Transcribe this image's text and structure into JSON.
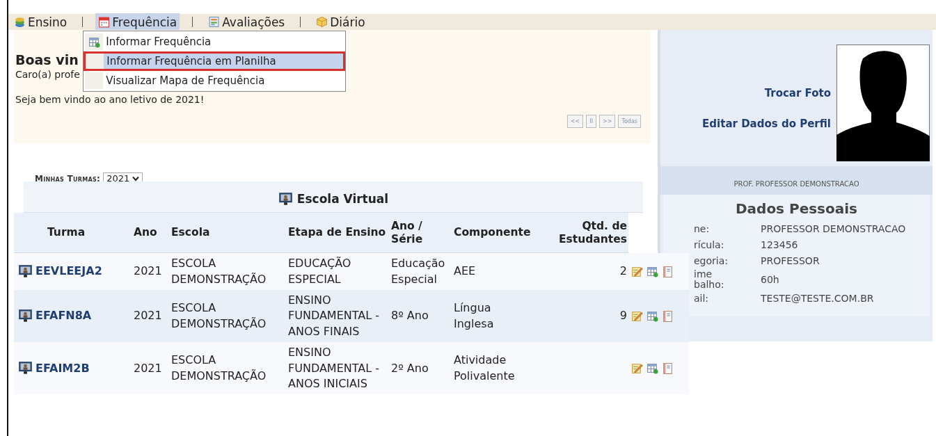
{
  "menu": [
    {
      "label": "Ensino",
      "kind": "books",
      "selected": false
    },
    {
      "label": "Frequência",
      "kind": "calendar",
      "selected": true
    },
    {
      "label": "Avaliações",
      "kind": "form",
      "selected": false
    },
    {
      "label": "Diário",
      "kind": "box",
      "selected": false
    }
  ],
  "dropdown": [
    {
      "label": "Informar Frequência",
      "kind": "sheet",
      "selected": false
    },
    {
      "label": "Informar Frequência em Planilha",
      "kind": "none",
      "selected": true
    },
    {
      "label": "Visualizar Mapa de Frequência",
      "kind": "none",
      "selected": false
    }
  ],
  "welcome": {
    "title": "Boas vin",
    "greeting": "Caro(a) profe",
    "message": "Seja bem vindo ao ano letivo de 2021!",
    "pager": [
      "<<",
      "II",
      ">>",
      "Todas"
    ]
  },
  "classes_filter": {
    "label": "Minhas Turmas:",
    "value": "2021"
  },
  "table": {
    "caption": "Escola Virtual",
    "columns": [
      "Turma",
      "Ano",
      "Escola",
      "Etapa de Ensino",
      "Ano / Série",
      "Componente",
      "Qtd. de Estudantes"
    ],
    "rows": [
      {
        "turma": "EEVLEEJA2",
        "ano": "2021",
        "escola": "ESCOLA DEMONSTRAÇÃO",
        "etapa": "EDUCAÇÃO ESPECIAL",
        "serie": "Educação Especial",
        "componente": "AEE",
        "qtd": "2"
      },
      {
        "turma": "EFAFN8A",
        "ano": "2021",
        "escola": "ESCOLA DEMONSTRAÇÃO",
        "etapa": "ENSINO FUNDAMENTAL - ANOS FINAIS",
        "serie": "8º Ano",
        "componente": "Língua Inglesa",
        "qtd": "9"
      },
      {
        "turma": "EFAIM2B",
        "ano": "2021",
        "escola": "ESCOLA DEMONSTRAÇÃO",
        "etapa": "ENSINO FUNDAMENTAL - ANOS INICIAIS",
        "serie": "2º Ano",
        "componente": "Atividade Polivalente",
        "qtd": ""
      }
    ]
  },
  "profile": {
    "links": [
      "Trocar Foto",
      "Editar Dados do Perfil"
    ],
    "name_band": "PROF. PROFESSOR DEMONSTRACAO",
    "section_title": "Dados Pessoais",
    "fields": [
      {
        "label": "ne:",
        "value": "PROFESSOR DEMONSTRACAO"
      },
      {
        "label": "rícula:",
        "value": "123456"
      },
      {
        "label": "egoria:",
        "value": "PROFESSOR"
      },
      {
        "label": "ime balho:",
        "value": "60h"
      },
      {
        "label": "ail:",
        "value": "TESTE@TESTE.COM.BR"
      }
    ]
  }
}
